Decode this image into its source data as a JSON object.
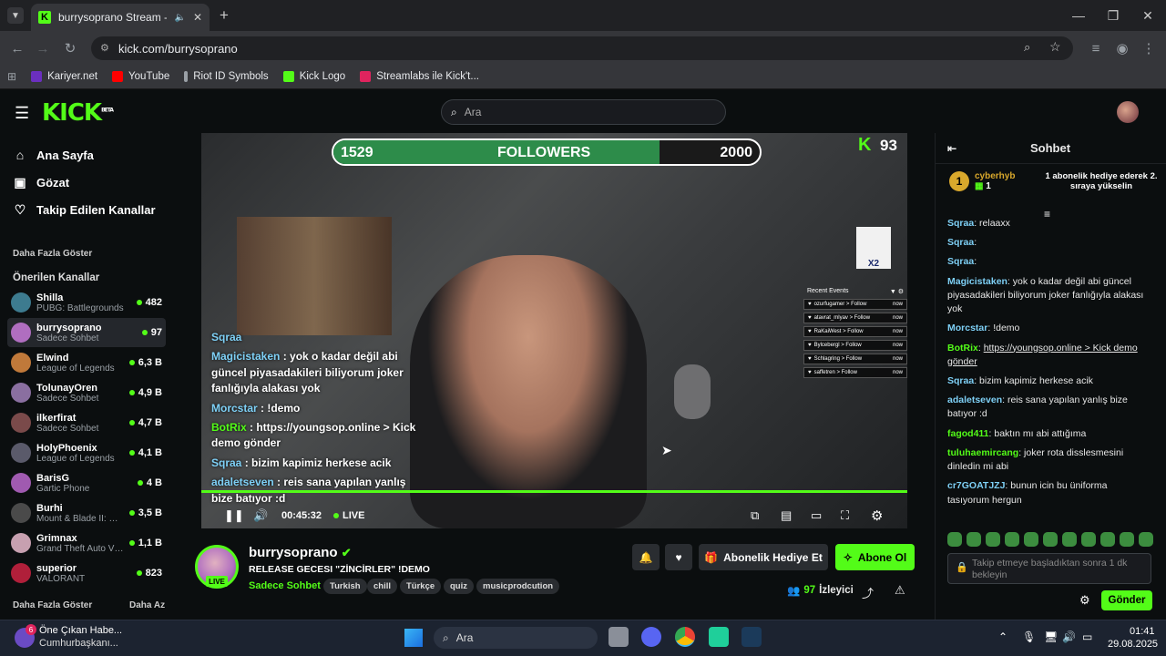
{
  "browser": {
    "tab_title": "burrysoprano Stream - Wat",
    "url": "kick.com/burrysoprano",
    "bookmarks": [
      {
        "label": "Kariyer.net",
        "color": "#6b2fbf"
      },
      {
        "label": "YouTube",
        "color": "#ff0000"
      },
      {
        "label": "Riot ID Symbols",
        "color": "#9aa0a6"
      },
      {
        "label": "Kick Logo",
        "color": "#53fc18"
      },
      {
        "label": "Streamlabs ile Kick't...",
        "color": "#e0245e"
      }
    ]
  },
  "header": {
    "logo": "KICK",
    "logo_sup": "BETA",
    "search_placeholder": "Ara"
  },
  "sidebar": {
    "nav": [
      {
        "label": "Ana Sayfa",
        "icon": "home-icon"
      },
      {
        "label": "Gözat",
        "icon": "browse-icon"
      },
      {
        "label": "Takip Edilen Kanallar",
        "icon": "heart-icon"
      }
    ],
    "show_more": "Daha Fazla Göster",
    "recommended_title": "Önerilen Kanallar",
    "channels": [
      {
        "name": "Shilla",
        "game": "PUBG: Battlegrounds",
        "viewers": "482",
        "color": "#3d7b8f"
      },
      {
        "name": "burrysoprano",
        "game": "Sadece Sohbet",
        "viewers": "97",
        "color": "#b06ec0"
      },
      {
        "name": "Elwind",
        "game": "League of Legends",
        "viewers": "6,3 B",
        "color": "#c0793a"
      },
      {
        "name": "TolunayOren",
        "game": "Sadece Sohbet",
        "viewers": "4,9 B",
        "color": "#8a6fa0"
      },
      {
        "name": "ilkerfirat",
        "game": "Sadece Sohbet",
        "viewers": "4,7 B",
        "color": "#7a4a4a"
      },
      {
        "name": "HolyPhoenix",
        "game": "League of Legends",
        "viewers": "4,1 B",
        "color": "#5a5a6a"
      },
      {
        "name": "BarisG",
        "game": "Gartic Phone",
        "viewers": "4 B",
        "color": "#a05ab0"
      },
      {
        "name": "Burhi",
        "game": "Mount & Blade II: Ba...",
        "viewers": "3,5 B",
        "color": "#4a4a4a"
      },
      {
        "name": "Grimnax",
        "game": "Grand Theft Auto V (G...",
        "viewers": "1,1 B",
        "color": "#c7a0b0"
      },
      {
        "name": "superior",
        "game": "VALORANT",
        "viewers": "823",
        "color": "#b01f3a"
      }
    ],
    "footer_more": "Daha Fazla Göster",
    "footer_less": "Daha Az"
  },
  "video": {
    "followers_current": "1529",
    "followers_label": "FOLLOWERS",
    "followers_goal": "2000",
    "followers_progress": 0.765,
    "viewer_overlay": "93",
    "badge_text": "X2",
    "recent_title": "Recent Events",
    "recent_events": [
      "ozurfugamer > Follow",
      "atavrat_mlyav > Follow",
      "RaKaiWest > Follow",
      "Bylcebergl > Follow",
      "Schlagring > Follow",
      "saffetren > Follow"
    ],
    "recent_when": "now",
    "overlay_chat": [
      {
        "user": "Sqraa",
        "text": ""
      },
      {
        "user": "Magicistaken",
        "text": "yok o kadar değil abi güncel piyasadakileri biliyorum joker fanlığıyla alakası yok"
      },
      {
        "user": "Morcstar",
        "text": "!demo"
      },
      {
        "user": "BotRix",
        "text": "https://youngsop.online > Kick demo gönder"
      },
      {
        "user": "Sqraa",
        "text": "bizim kapimiz herkese acik"
      },
      {
        "user": "adaletseven",
        "text": "reis sana yapılan yanlış bize batıyor :d"
      }
    ],
    "time": "00:45:32",
    "live_label": "LIVE"
  },
  "streamer": {
    "name": "burrysoprano",
    "live_badge": "LIVE",
    "title": "RELEASE GECESI \"ZİNCİRLER\" !DEMO",
    "category": "Sadece Sohbet",
    "tags": [
      "Turkish",
      "chill",
      "Türkçe",
      "quiz",
      "musicprodcution"
    ],
    "gift_label": "Abonelik Hediye Et",
    "subscribe_label": "Abone Ol",
    "viewers": "97",
    "viewers_label": "İzleyici"
  },
  "chat": {
    "title": "Sohbet",
    "pinned_rank": "1",
    "pinned_user": "cyberhyb",
    "pinned_count": "1",
    "pinned_text": "1 abonelik hediye ederek 2. sıraya yükselin",
    "messages": [
      {
        "user": "Sqraa",
        "text": "relaaxx",
        "ucolor": "#7ed0f6"
      },
      {
        "user": "Sqraa",
        "text": "",
        "ucolor": "#7ed0f6"
      },
      {
        "user": "Sqraa",
        "text": "",
        "ucolor": "#7ed0f6"
      },
      {
        "user": "Magicistaken",
        "text": "yok o kadar değil abi güncel piyasadakileri biliyorum joker fanlığıyla alakası yok",
        "ucolor": "#7ed0f6"
      },
      {
        "user": "Morcstar",
        "text": "!demo",
        "ucolor": "#7ed0f6"
      },
      {
        "user": "BotRix",
        "text": "https://youngsop.online > Kick demo gönder",
        "ucolor": "#53fc18"
      },
      {
        "user": "Sqraa",
        "text": "bizim kapimiz herkese acik",
        "ucolor": "#7ed0f6"
      },
      {
        "user": "adaletseven",
        "text": "reis sana yapılan yanlış bize batıyor :d",
        "ucolor": "#7ed0f6"
      },
      {
        "user": "fagod411",
        "text": "baktın mı abi attığıma",
        "ucolor": "#53fc18"
      },
      {
        "user": "tuluhaemircang",
        "text": "joker rota disslesmesini dinledin mi abi",
        "ucolor": "#53fc18"
      },
      {
        "user": "cr7GOATJZJ",
        "text": "bunun icin bu üniforma tasıyorum hergun",
        "ucolor": "#7ed0f6"
      }
    ],
    "input_placeholder": "Takip etmeye başladıktan sonra 1 dk bekleyin",
    "send_label": "Gönder"
  },
  "taskbar": {
    "news_title": "Öne Çıkan Habe...",
    "news_sub": "Cumhurbaşkanı...",
    "news_badge": "6",
    "search_label": "Ara",
    "time": "01:41",
    "date": "29.08.2025"
  }
}
